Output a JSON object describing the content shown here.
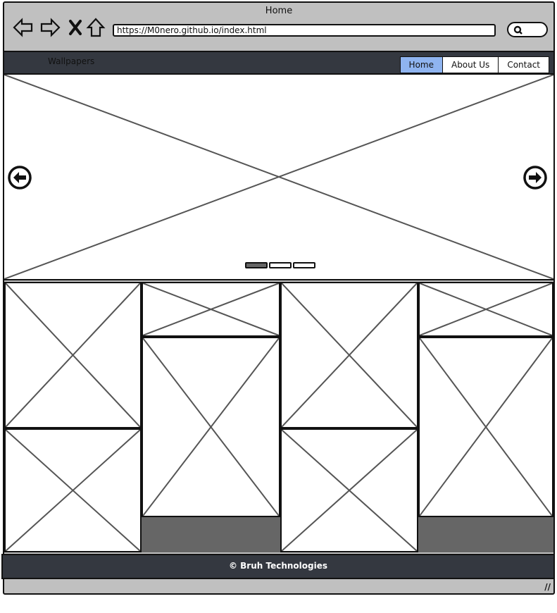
{
  "window": {
    "title": "Home"
  },
  "address_bar": {
    "url": "https://M0nero.github.io/index.html"
  },
  "icons": {
    "back": "back-arrow-icon",
    "forward": "forward-arrow-icon",
    "stop": "close-icon",
    "home": "home-icon",
    "search": "search-icon",
    "prev_slide": "arrow-left-circle-icon",
    "next_slide": "arrow-right-circle-icon"
  },
  "navbar": {
    "brand": "Wallpapers",
    "links": [
      {
        "label": "Home",
        "active": true
      },
      {
        "label": "About Us",
        "active": false
      },
      {
        "label": "Contact",
        "active": false
      }
    ]
  },
  "carousel": {
    "indicator_count": 3,
    "active_indicator": 0
  },
  "footer": {
    "text": "© Bruh Technologies"
  },
  "colors": {
    "frame": "#c0c0c0",
    "navbar_bg": "#343840",
    "active_link": "#8fb4f0",
    "placeholder_fill": "#666666"
  }
}
